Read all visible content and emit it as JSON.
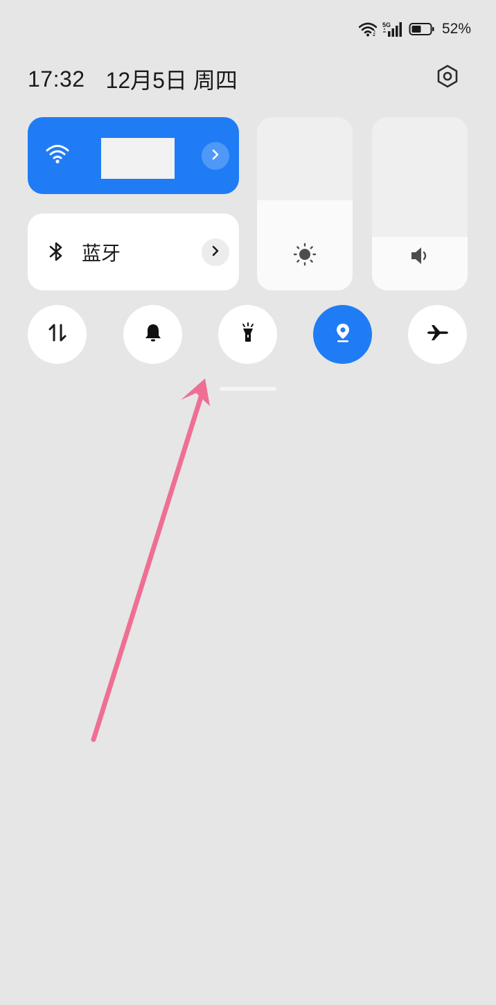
{
  "status_bar": {
    "network_label": "5G",
    "battery_percent": "52%",
    "battery_level": 0.52
  },
  "header": {
    "time": "17:32",
    "date": "12月5日 周四"
  },
  "tiles": {
    "wifi": {
      "active": true,
      "network_name": "",
      "accent": "#1f7cf5"
    },
    "bluetooth": {
      "label": "蓝牙",
      "active": false
    }
  },
  "sliders": {
    "brightness": {
      "level": 0.52
    },
    "volume": {
      "level": 0.31
    }
  },
  "toggles": [
    {
      "icon": "mobile-data-icon",
      "active": false
    },
    {
      "icon": "bell-icon",
      "active": false
    },
    {
      "icon": "flashlight-icon",
      "active": false
    },
    {
      "icon": "location-icon",
      "active": true
    },
    {
      "icon": "airplane-icon",
      "active": false
    }
  ],
  "annotation": {
    "color": "#ef6f93"
  }
}
